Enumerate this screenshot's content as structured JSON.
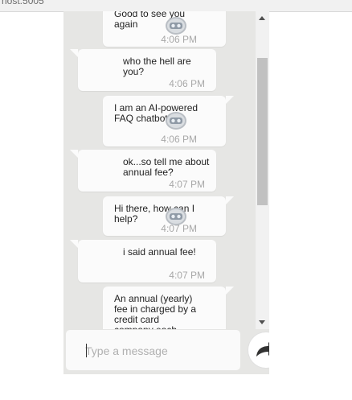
{
  "browser": {
    "address_fragment": "nost:5005"
  },
  "messages": [
    {
      "sender": "bot",
      "text": "Good to see you again",
      "time": "4:06 PM"
    },
    {
      "sender": "user",
      "text": "who the hell are you?",
      "time": "4:06 PM"
    },
    {
      "sender": "bot",
      "text": "I am an AI-powered FAQ chatbot :)",
      "time": "4:06 PM"
    },
    {
      "sender": "user",
      "text": "ok...so tell me about annual fee?",
      "time": "4:07 PM"
    },
    {
      "sender": "bot",
      "text": "Hi there, how can I help?",
      "time": "4:07 PM"
    },
    {
      "sender": "user",
      "text": "i said annual fee!",
      "time": "4:07 PM"
    },
    {
      "sender": "bot",
      "text": "An annual (yearly) fee in charged by a credit card company each",
      "time": ""
    }
  ],
  "composer": {
    "placeholder": "Type a message"
  },
  "icons": {
    "send": "send-arrow-icon",
    "user_avatar": "user-avatar-icon",
    "bot_avatar": "bot-avatar-icon"
  },
  "colors": {
    "chat_bg": "#e6e6e4",
    "bubble": "#fbfbfb",
    "timestamp": "#a8a8a8"
  }
}
